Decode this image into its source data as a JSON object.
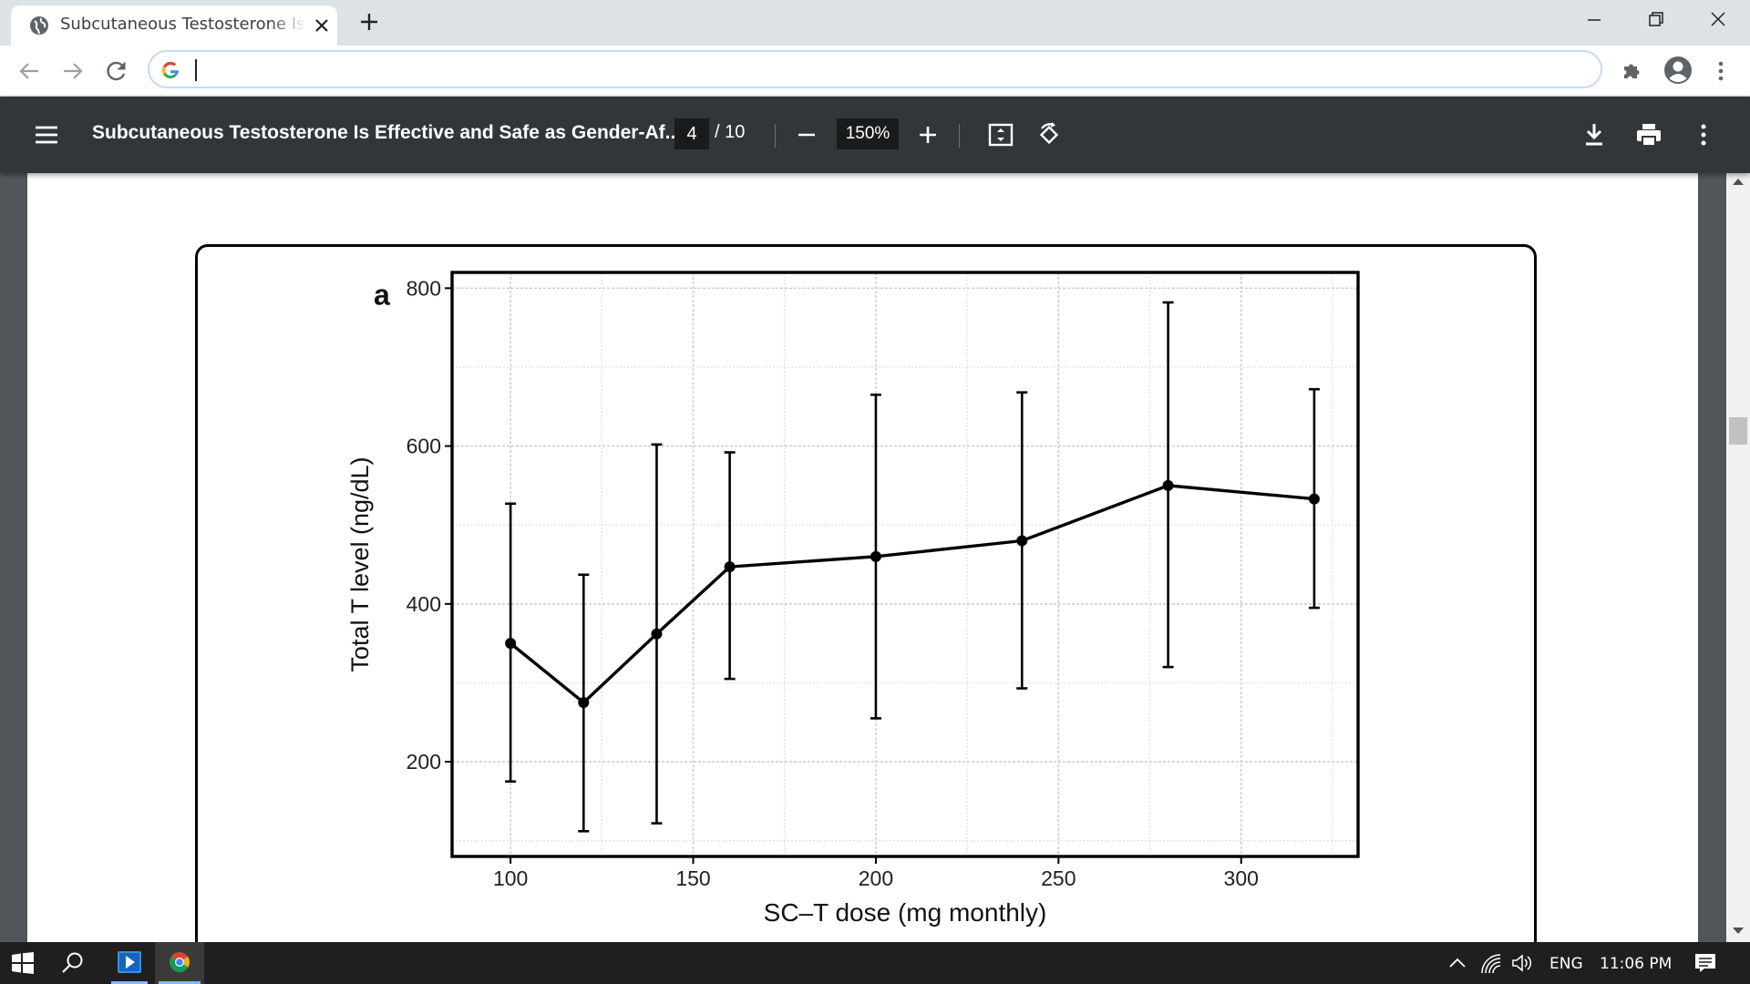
{
  "browser": {
    "tab_title": "Subcutaneous Testosterone Is Effective and Safe as Gender-Affirming Hormone Therapy",
    "address_value": ""
  },
  "pdf_toolbar": {
    "title": "Subcutaneous Testosterone Is Effective and Safe as Gender-Af...",
    "current_page": "4",
    "total_pages": "/ 10",
    "zoom": "150%"
  },
  "chart_data": {
    "type": "line",
    "panel_label": "a",
    "xlabel": "SC–T dose (mg monthly)",
    "ylabel": "Total T level (ng/dL)",
    "xlim": [
      84,
      332
    ],
    "ylim": [
      80,
      820
    ],
    "xticks": [
      100,
      150,
      200,
      250,
      300
    ],
    "yticks": [
      200,
      400,
      600,
      800
    ],
    "grid": true,
    "series": [
      {
        "x": [
          100,
          120,
          140,
          160,
          200,
          240,
          280,
          320
        ],
        "y": [
          350,
          275,
          362,
          447,
          460,
          480,
          550,
          533
        ],
        "err_low": [
          175,
          112,
          122,
          305,
          255,
          293,
          320,
          395
        ],
        "err_high": [
          527,
          437,
          602,
          592,
          665,
          668,
          782,
          672
        ]
      }
    ]
  },
  "taskbar": {
    "language": "ENG",
    "time": "11:06 PM"
  },
  "colors": {
    "tabstrip": "#dee1e6",
    "pdf_toolbar": "#323639",
    "viewer_bg": "#525659",
    "taskbar": "#1f1f1f"
  }
}
